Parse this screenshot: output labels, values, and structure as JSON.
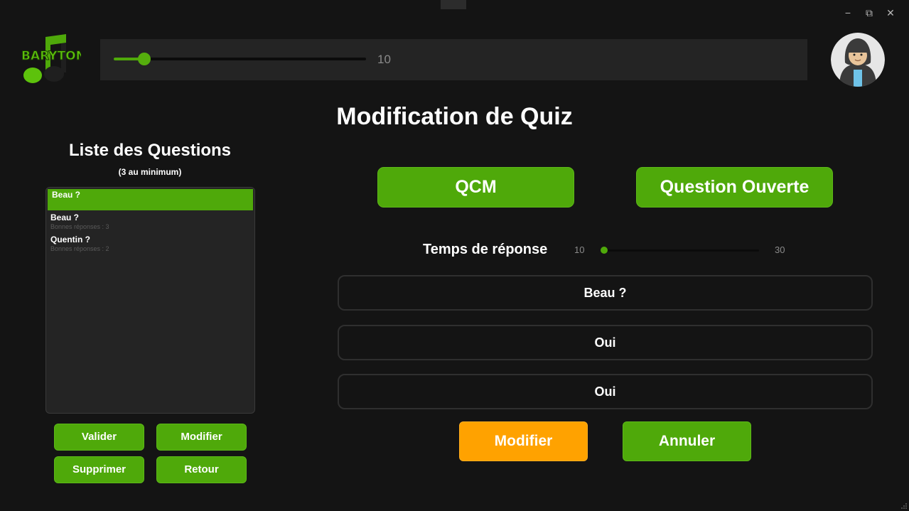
{
  "window": {
    "minimize_glyph": "−",
    "maximize_glyph": "⧉",
    "close_glyph": "✕"
  },
  "header": {
    "logo_text": "BARYTON",
    "volume": {
      "value_text": "10",
      "level": 0.12
    }
  },
  "page_title": "Modification de Quiz",
  "question_list": {
    "title": "Liste des Questions",
    "subtitle": "(3 au minimum)",
    "items": [
      {
        "name": "Beau ?",
        "sub": "",
        "selected": true
      },
      {
        "name": "Beau ?",
        "sub": "Bonnes réponses : 3",
        "selected": false
      },
      {
        "name": "Quentin ?",
        "sub": "Bonnes réponses : 2",
        "selected": false
      }
    ]
  },
  "list_buttons": {
    "validate": "Valider",
    "modify": "Modifier",
    "delete": "Supprimer",
    "back": "Retour"
  },
  "question_type": {
    "mcq": "QCM",
    "open": "Question Ouverte"
  },
  "response_time": {
    "label": "Temps de réponse",
    "min": "10",
    "max": "30",
    "level": 0.0
  },
  "fields": {
    "question": "Beau ?",
    "answer_1": "Oui",
    "answer_2": "Oui"
  },
  "actions": {
    "modify": "Modifier",
    "cancel": "Annuler"
  },
  "colors": {
    "background": "#141414",
    "panel": "#242424",
    "accent_green": "#4fa90a",
    "accent_orange": "#ffa200"
  }
}
